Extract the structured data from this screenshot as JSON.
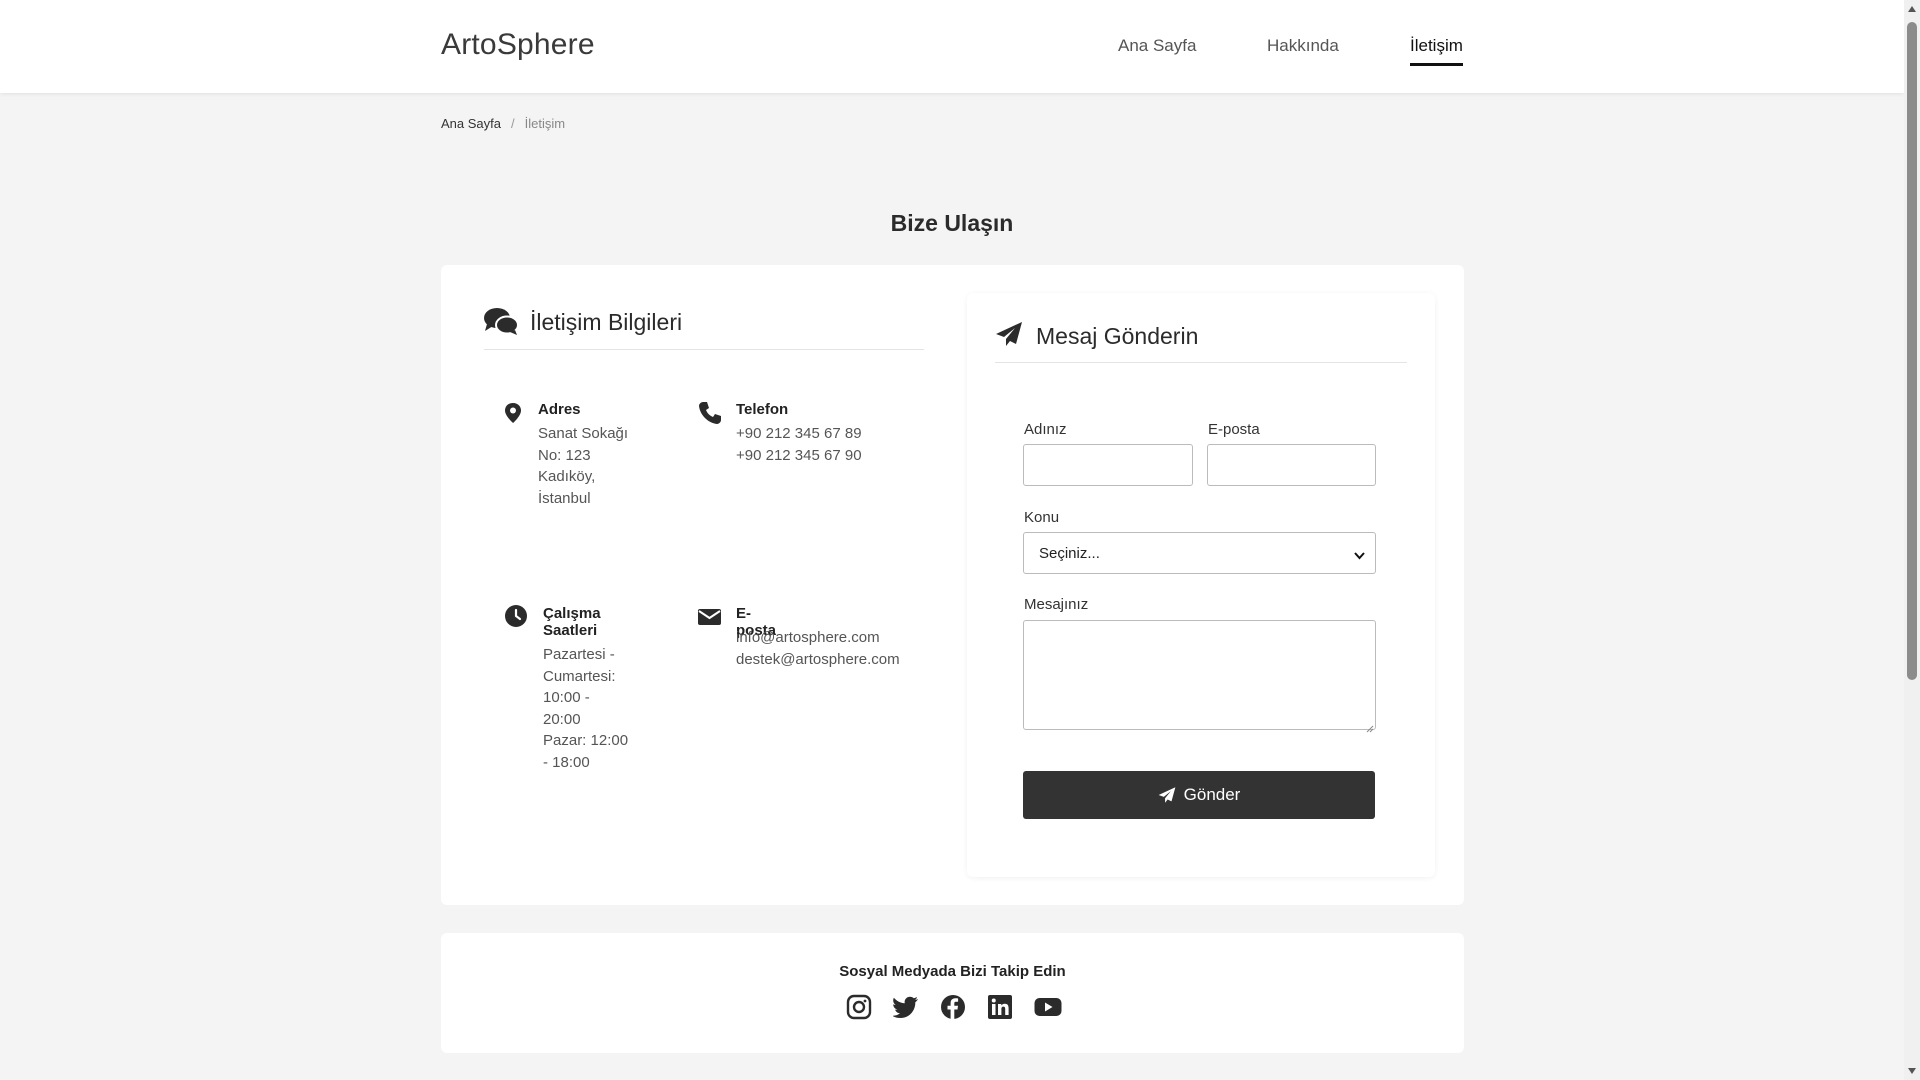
{
  "header": {
    "brand": "ArtoSphere",
    "nav": [
      "Ana Sayfa",
      "Hakkında",
      "İletişim"
    ],
    "active": "İletişim"
  },
  "breadcrumb": {
    "home": "Ana Sayfa",
    "separator": "/",
    "current": "İletişim"
  },
  "page_title": "Bize Ulaşın",
  "info": {
    "title": "İletişim Bilgileri",
    "title_icon": "comments-icon",
    "address": {
      "label": "Adres",
      "lines": [
        "Sanat Sokağı",
        "No: 123",
        "Kadıköy,",
        "İstanbul"
      ],
      "icon": "map-pin-icon"
    },
    "phone": {
      "label": "Telefon",
      "lines": [
        "+90 212 345 67 89",
        "+90 212 345 67 90"
      ],
      "icon": "phone-icon"
    },
    "hours": {
      "label_lines": [
        "Çalışma",
        "Saatleri"
      ],
      "lines": [
        "Pazartesi -",
        "Cumartesi:",
        "10:00 -",
        "20:00",
        "Pazar: 12:00",
        "- 18:00"
      ],
      "icon": "clock-icon"
    },
    "email": {
      "label": "E-posta",
      "lines": [
        "info@artosphere.com",
        "destek@artosphere.com"
      ],
      "icon": "envelope-icon"
    }
  },
  "form": {
    "title": "Mesaj Gönderin",
    "title_icon": "paper-plane-icon",
    "name_label": "Adınız",
    "name_value": "",
    "email_label": "E-posta",
    "email_value": "",
    "subject_label": "Konu",
    "subject_selected": "Seçiniz...",
    "message_label": "Mesajınız",
    "message_value": "",
    "submit_label": "Gönder"
  },
  "social": {
    "title": "Sosyal Medyada Bizi Takip Edin",
    "icons": [
      "instagram-icon",
      "twitter-icon",
      "facebook-icon",
      "linkedin-icon",
      "youtube-icon"
    ]
  },
  "colors": {
    "background": "#f4f4f4",
    "card": "#ffffff",
    "primary_button": "#333333",
    "text": "#2b2b2b"
  }
}
